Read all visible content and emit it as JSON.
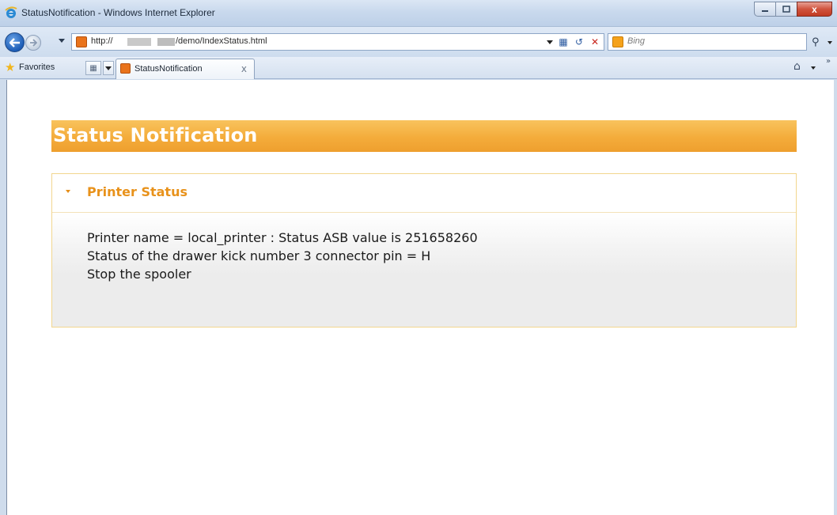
{
  "window": {
    "title": "StatusNotification - Windows Internet Explorer",
    "close_glyph": "x"
  },
  "address_bar": {
    "url_prefix": "http://",
    "url_suffix": "/demo/IndexStatus.html"
  },
  "search_box": {
    "placeholder": "Bing"
  },
  "favorites_bar": {
    "favorites_label": "Favorites",
    "tab_label": "StatusNotification",
    "tab_close": "x"
  },
  "page": {
    "heading": "Status Notification",
    "panel": {
      "title": "Printer Status",
      "messages": [
        "Printer name = local_printer : Status ASB value is 251658260",
        "Status of the drawer kick number 3 connector pin = H",
        "Stop the spooler"
      ]
    }
  },
  "colors": {
    "banner_orange": "#f4ac3b",
    "panel_title": "#e8921b",
    "panel_border": "#f2d68e"
  },
  "icons": [
    "ie-logo-icon",
    "minimize-icon",
    "maximize-icon",
    "close-icon",
    "back-arrow-icon",
    "forward-arrow-icon",
    "xml-page-icon",
    "compatibility-view-icon",
    "refresh-icon",
    "stop-icon",
    "bing-icon",
    "search-icon",
    "favorites-star-icon",
    "quick-tabs-icon",
    "home-icon"
  ]
}
